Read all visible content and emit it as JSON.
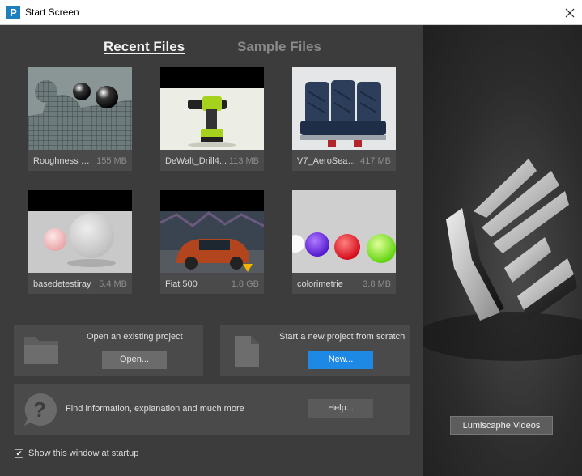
{
  "window": {
    "title": "Start Screen",
    "app_icon_letter": "P"
  },
  "tabs": {
    "recent": "Recent Files",
    "sample": "Sample Files"
  },
  "files": [
    {
      "name": "Roughness m...",
      "size": "155 MB"
    },
    {
      "name": "DeWalt_Drill4...",
      "size": "113 MB"
    },
    {
      "name": "V7_AeroSeat_...",
      "size": "417 MB"
    },
    {
      "name": "basedetestiray",
      "size": "5.4 MB"
    },
    {
      "name": "Fiat 500",
      "size": "1.8 GB"
    },
    {
      "name": "colorimetrie",
      "size": "3.8 MB"
    }
  ],
  "open_panel": {
    "label": "Open an existing project",
    "button": "Open..."
  },
  "new_panel": {
    "label": "Start a new project from scratch",
    "button": "New..."
  },
  "help_panel": {
    "label": "Find information, explanation and much more",
    "button": "Help..."
  },
  "startup": {
    "label": "Show this window at startup",
    "checked": true
  },
  "sidebar": {
    "videos_button": "Lumiscaphe Videos"
  },
  "colors": {
    "accent": "#1e88e5",
    "background": "#3c3c3c",
    "card": "#4a4a4a"
  }
}
